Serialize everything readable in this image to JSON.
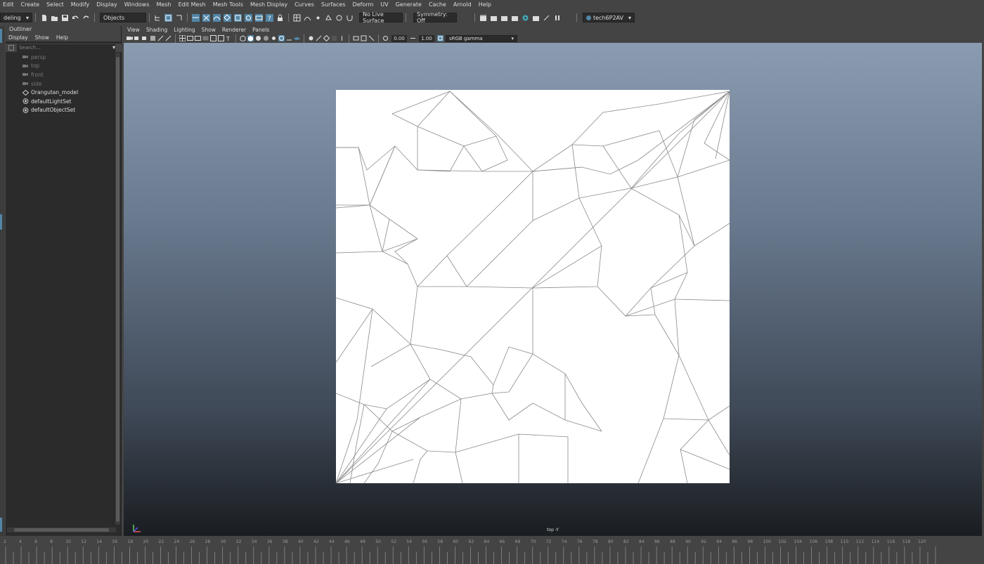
{
  "menubar": {
    "items": [
      "Edit",
      "Create",
      "Select",
      "Modify",
      "Display",
      "Windows",
      "Mesh",
      "Edit Mesh",
      "Mesh Tools",
      "Mesh Display",
      "Curves",
      "Surfaces",
      "Deform",
      "UV",
      "Generate",
      "Cache",
      "Arnold",
      "Help"
    ]
  },
  "statusline": {
    "workspace": "deling",
    "selection_mode": "Objects",
    "live_surface": "No Live Surface",
    "symmetry": "Symmetry: Off",
    "user": "tech6P2AV"
  },
  "outliner": {
    "title": "Outliner",
    "menu": [
      "Display",
      "Show",
      "Help"
    ],
    "search_placeholder": "Search...",
    "items": [
      {
        "label": "persp",
        "icon": "camera-icon",
        "dim": true
      },
      {
        "label": "top",
        "icon": "camera-icon",
        "dim": true
      },
      {
        "label": "front",
        "icon": "camera-icon",
        "dim": true
      },
      {
        "label": "side",
        "icon": "camera-icon",
        "dim": true
      },
      {
        "label": "Orangutan_model",
        "icon": "mesh-transform-icon",
        "dim": false
      },
      {
        "label": "defaultLightSet",
        "icon": "set-icon",
        "dim": false
      },
      {
        "label": "defaultObjectSet",
        "icon": "set-icon",
        "dim": false
      }
    ]
  },
  "viewport": {
    "menu": [
      "View",
      "Shading",
      "Lighting",
      "Show",
      "Renderer",
      "Panels"
    ],
    "exposure": "0.00",
    "gamma": "1.00",
    "color_space": "sRGB gamma",
    "camera_label": "top -Y"
  },
  "timeslider": {
    "ticks": [
      2,
      4,
      6,
      8,
      10,
      12,
      14,
      16,
      18,
      20,
      22,
      24,
      26,
      28,
      30,
      32,
      34,
      36,
      38,
      40,
      42,
      44,
      46,
      48,
      50,
      52,
      54,
      56,
      58,
      60,
      62,
      64,
      66,
      68,
      70,
      72,
      74,
      76,
      78,
      80,
      82,
      84,
      86,
      88,
      90,
      92,
      94,
      96,
      98,
      100,
      102,
      104,
      106,
      108,
      110,
      112,
      114,
      116,
      118,
      120
    ]
  },
  "colors": {
    "accent": "#5285a6",
    "panel": "#444444",
    "field": "#2b2b2b"
  }
}
